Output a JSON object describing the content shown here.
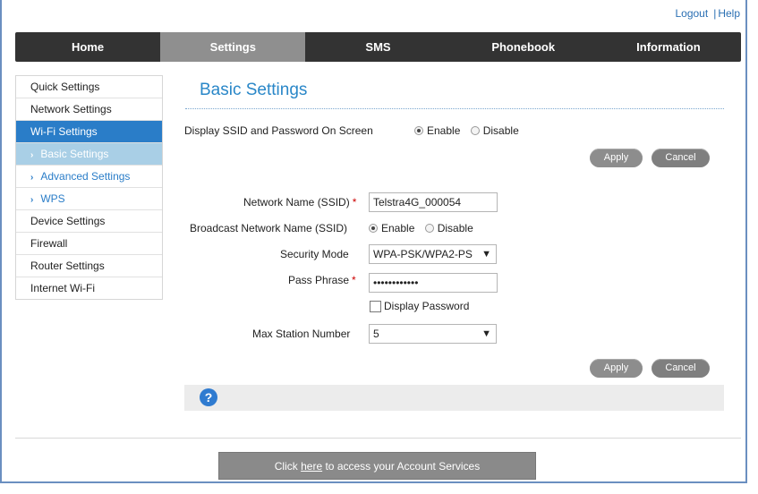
{
  "top_links": {
    "logout": "Logout",
    "help": "Help",
    "separator": "|"
  },
  "nav": {
    "tabs": [
      "Home",
      "Settings",
      "SMS",
      "Phonebook",
      "Information"
    ]
  },
  "sidebar": {
    "items": [
      "Quick Settings",
      "Network Settings",
      "Wi-Fi Settings",
      "Device Settings",
      "Firewall",
      "Router Settings",
      "Internet Wi-Fi"
    ],
    "sub_items": [
      "Basic Settings",
      "Advanced Settings",
      "WPS"
    ],
    "chevron": "›"
  },
  "page": {
    "title": "Basic Settings"
  },
  "display_ssid": {
    "label": "Display SSID and Password On Screen",
    "enable": "Enable",
    "disable": "Disable",
    "selected": "Enable"
  },
  "buttons": {
    "apply": "Apply",
    "cancel": "Cancel"
  },
  "form": {
    "required_mark": "*",
    "ssid_label": "Network Name (SSID)",
    "ssid_value": "Telstra4G_000054",
    "broadcast_label": "Broadcast Network Name (SSID)",
    "broadcast_enable": "Enable",
    "broadcast_disable": "Disable",
    "broadcast_selected": "Enable",
    "security_label": "Security Mode",
    "security_value": "WPA-PSK/WPA2-PS",
    "passphrase_label": "Pass Phrase",
    "passphrase_value": "••••••••••••",
    "display_password_label": "Display Password",
    "display_password_checked": false,
    "max_station_label": "Max Station Number",
    "max_station_value": "5",
    "dropdown_arrow": "▼"
  },
  "help_icon": "?",
  "footer": {
    "prefix": "Click ",
    "link": "here",
    "suffix": " to access your Account Services"
  },
  "colors": {
    "accent": "#2a7dc8",
    "nav_bg": "#333333",
    "nav_active": "#8f8f8f"
  }
}
